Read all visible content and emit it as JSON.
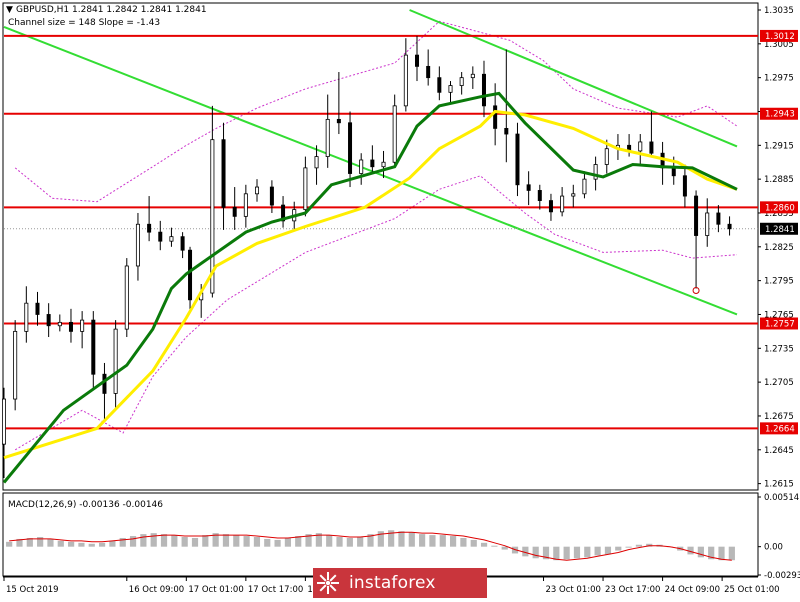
{
  "header": {
    "symbol_line": "GBPUSD,H1  1.2841 1.2842 1.2841 1.2841",
    "channel_line": "Channel size = 148 Slope = -1.43",
    "macd_line": "MACD(12,26,9) -0.00136 -0.00146"
  },
  "watermark": {
    "text": "instaforex"
  },
  "colors": {
    "background": "#ffffff",
    "candles": "#000000",
    "support_resistance": "#e60000",
    "channel": "#33dd33",
    "ma_fast": "#0a7a0a",
    "ma_slow": "#ffee00",
    "envelope": "#cc33cc",
    "macd_bars": "#b8b8b8",
    "macd_signal": "#dd0000"
  },
  "chart_data": [
    {
      "type": "candlestick",
      "symbol": "GBPUSD",
      "timeframe": "H1",
      "ylim": [
        1.2612,
        1.3035
      ],
      "xlim": [
        "2019-10-15 00:00",
        "2019-10-25 05:00"
      ],
      "y_ticks": [
        "1.3035",
        "1.3005",
        "1.2975",
        "1.2945",
        "1.2915",
        "1.2885",
        "1.2855",
        "1.2825",
        "1.2795",
        "1.2765",
        "1.2735",
        "1.2705",
        "1.2675",
        "1.2645",
        "1.2615"
      ],
      "x_ticks": [
        {
          "t": "2019-10-15 00:00",
          "label": "15 Oct 2019"
        },
        {
          "t": "2019-10-16 09:00",
          "label": "16 Oct 09:00"
        },
        {
          "t": "2019-10-17 01:00",
          "label": "17 Oct 01:00"
        },
        {
          "t": "2019-10-17 17:00",
          "label": "17 Oct 17:00"
        },
        {
          "t": "2019-10-18 09:00",
          "label": "18 Oct 09:00"
        },
        {
          "t": "2019-10-23 01:00",
          "label": "23 Oct 01:00"
        },
        {
          "t": "2019-10-23 17:00",
          "label": "23 Oct 17:00"
        },
        {
          "t": "2019-10-24 09:00",
          "label": "24 Oct 09:00"
        },
        {
          "t": "2019-10-25 01:00",
          "label": "25 Oct 01:00"
        }
      ],
      "current_price": {
        "value": 1.2841,
        "label": "1.2841"
      },
      "levels": [
        {
          "value": 1.3012,
          "label": "1.3012"
        },
        {
          "value": 1.2943,
          "label": "1.2943"
        },
        {
          "value": 1.286,
          "label": "1.2860"
        },
        {
          "value": 1.2757,
          "label": "1.2757"
        },
        {
          "value": 1.2664,
          "label": "1.2664"
        }
      ],
      "channel_lines": [
        {
          "from": [
            "2019-10-15 00:00",
            1.302
          ],
          "to": [
            "2019-10-25 05:00",
            1.2765
          ]
        },
        {
          "from": [
            "2019-10-21 13:00",
            1.3035
          ],
          "to": [
            "2019-10-25 05:00",
            1.2914
          ]
        }
      ],
      "ma_fast": [
        [
          "2019-10-15 00:00",
          1.2616
        ],
        [
          "2019-10-15 16:00",
          1.268
        ],
        [
          "2019-10-16 09:00",
          1.272
        ],
        [
          "2019-10-16 16:00",
          1.2752
        ],
        [
          "2019-10-16 21:00",
          1.2788
        ],
        [
          "2019-10-17 01:00",
          1.2801
        ],
        [
          "2019-10-17 04:00",
          1.2808
        ],
        [
          "2019-10-17 17:00",
          1.2838
        ],
        [
          "2019-10-18 00:00",
          1.2847
        ],
        [
          "2019-10-18 09:00",
          1.2855
        ],
        [
          "2019-10-18 16:00",
          1.288
        ],
        [
          "2019-10-21 09:00",
          1.2896
        ],
        [
          "2019-10-21 15:00",
          1.2932
        ],
        [
          "2019-10-21 21:00",
          1.295
        ],
        [
          "2019-10-22 08:00",
          1.2958
        ],
        [
          "2019-10-22 13:00",
          1.2961
        ],
        [
          "2019-10-22 20:00",
          1.2935
        ],
        [
          "2019-10-23 09:00",
          1.2893
        ],
        [
          "2019-10-23 17:00",
          1.2887
        ],
        [
          "2019-10-24 01:00",
          1.2898
        ],
        [
          "2019-10-24 09:00",
          1.2896
        ],
        [
          "2019-10-24 17:00",
          1.2895
        ],
        [
          "2019-10-25 05:00",
          1.2876
        ]
      ],
      "ma_slow": [
        [
          "2019-10-15 00:00",
          1.2638
        ],
        [
          "2019-10-16 01:00",
          1.2664
        ],
        [
          "2019-10-16 16:00",
          1.2715
        ],
        [
          "2019-10-17 01:00",
          1.2762
        ],
        [
          "2019-10-17 09:00",
          1.2808
        ],
        [
          "2019-10-17 20:00",
          1.2828
        ],
        [
          "2019-10-18 09:00",
          1.2843
        ],
        [
          "2019-10-21 01:00",
          1.286
        ],
        [
          "2019-10-21 13:00",
          1.2886
        ],
        [
          "2019-10-21 21:00",
          1.2912
        ],
        [
          "2019-10-22 08:00",
          1.2932
        ],
        [
          "2019-10-22 12:00",
          1.2945
        ],
        [
          "2019-10-22 20:00",
          1.2942
        ],
        [
          "2019-10-23 09:00",
          1.293
        ],
        [
          "2019-10-23 21:00",
          1.2912
        ],
        [
          "2019-10-24 13:00",
          1.29
        ],
        [
          "2019-10-24 21:00",
          1.2885
        ],
        [
          "2019-10-25 05:00",
          1.2876
        ]
      ],
      "envelope_upper": [
        [
          "2019-10-15 03:00",
          1.2895
        ],
        [
          "2019-10-15 13:00",
          1.2868
        ],
        [
          "2019-10-16 01:00",
          1.2865
        ],
        [
          "2019-10-16 16:00",
          1.2896
        ],
        [
          "2019-10-17 01:00",
          1.2915
        ],
        [
          "2019-10-17 09:00",
          1.293
        ],
        [
          "2019-10-17 20:00",
          1.2948
        ],
        [
          "2019-10-18 09:00",
          1.2965
        ],
        [
          "2019-10-21 09:00",
          1.2988
        ],
        [
          "2019-10-21 21:00",
          1.3025
        ],
        [
          "2019-10-22 05:00",
          1.3018
        ],
        [
          "2019-10-22 16:00",
          1.3008
        ],
        [
          "2019-10-23 01:00",
          1.299
        ],
        [
          "2019-10-23 09:00",
          1.2965
        ],
        [
          "2019-10-23 21:00",
          1.2948
        ],
        [
          "2019-10-24 13:00",
          1.294
        ],
        [
          "2019-10-24 21:00",
          1.295
        ],
        [
          "2019-10-25 05:00",
          1.2932
        ]
      ],
      "envelope_lower": [
        [
          "2019-10-15 03:00",
          1.2645
        ],
        [
          "2019-10-15 21:00",
          1.268
        ],
        [
          "2019-10-16 08:00",
          1.266
        ],
        [
          "2019-10-16 16:00",
          1.271
        ],
        [
          "2019-10-17 01:00",
          1.2745
        ],
        [
          "2019-10-17 12:00",
          1.2778
        ],
        [
          "2019-10-18 00:00",
          1.2802
        ],
        [
          "2019-10-18 09:00",
          1.282
        ],
        [
          "2019-10-21 09:00",
          1.285
        ],
        [
          "2019-10-21 21:00",
          1.2876
        ],
        [
          "2019-10-22 08:00",
          1.2888
        ],
        [
          "2019-10-22 20:00",
          1.2855
        ],
        [
          "2019-10-23 04:00",
          1.2836
        ],
        [
          "2019-10-23 17:00",
          1.282
        ],
        [
          "2019-10-24 09:00",
          1.2822
        ],
        [
          "2019-10-24 17:00",
          1.2815
        ],
        [
          "2019-10-25 05:00",
          1.2818
        ]
      ],
      "ohlc": [
        [
          "2019-10-15 00:00",
          1.265,
          1.27,
          1.262,
          1.269
        ],
        [
          "2019-10-15 03:00",
          1.269,
          1.276,
          1.268,
          1.275
        ],
        [
          "2019-10-15 06:00",
          1.275,
          1.279,
          1.274,
          1.2775
        ],
        [
          "2019-10-15 09:00",
          1.2775,
          1.2785,
          1.2755,
          1.2765
        ],
        [
          "2019-10-15 12:00",
          1.2765,
          1.2775,
          1.2745,
          1.2755
        ],
        [
          "2019-10-15 15:00",
          1.2755,
          1.2765,
          1.275,
          1.2758
        ],
        [
          "2019-10-15 18:00",
          1.2758,
          1.277,
          1.274,
          1.275
        ],
        [
          "2019-10-15 21:00",
          1.275,
          1.2768,
          1.2735,
          1.276
        ],
        [
          "2019-10-16 00:00",
          1.276,
          1.2768,
          1.27,
          1.2712
        ],
        [
          "2019-10-16 03:00",
          1.2712,
          1.2722,
          1.267,
          1.2695
        ],
        [
          "2019-10-16 06:00",
          1.2695,
          1.276,
          1.268,
          1.2752
        ],
        [
          "2019-10-16 09:00",
          1.2752,
          1.2815,
          1.2745,
          1.2808
        ],
        [
          "2019-10-16 12:00",
          1.2808,
          1.2855,
          1.2795,
          1.2845
        ],
        [
          "2019-10-16 15:00",
          1.2845,
          1.287,
          1.283,
          1.2838
        ],
        [
          "2019-10-16 18:00",
          1.2838,
          1.2848,
          1.2822,
          1.283
        ],
        [
          "2019-10-16 21:00",
          1.283,
          1.2842,
          1.2825,
          1.2834
        ],
        [
          "2019-10-17 00:00",
          1.2834,
          1.2838,
          1.2815,
          1.2822
        ],
        [
          "2019-10-17 02:00",
          1.2822,
          1.2825,
          1.2768,
          1.2778
        ],
        [
          "2019-10-17 05:00",
          1.2778,
          1.2792,
          1.2762,
          1.2784
        ],
        [
          "2019-10-17 08:00",
          1.2784,
          1.295,
          1.278,
          1.292
        ],
        [
          "2019-10-17 11:00",
          1.292,
          1.2935,
          1.284,
          1.286
        ],
        [
          "2019-10-17 14:00",
          1.286,
          1.2878,
          1.284,
          1.2852
        ],
        [
          "2019-10-17 17:00",
          1.2852,
          1.288,
          1.2842,
          1.2872
        ],
        [
          "2019-10-17 20:00",
          1.2872,
          1.2885,
          1.2865,
          1.2878
        ],
        [
          "2019-10-18 00:00",
          1.2878,
          1.2884,
          1.2855,
          1.2862
        ],
        [
          "2019-10-18 03:00",
          1.2862,
          1.287,
          1.2842,
          1.2848
        ],
        [
          "2019-10-18 06:00",
          1.2848,
          1.2865,
          1.284,
          1.2858
        ],
        [
          "2019-10-18 09:00",
          1.2858,
          1.2905,
          1.2852,
          1.2895
        ],
        [
          "2019-10-18 12:00",
          1.2895,
          1.2915,
          1.288,
          1.2905
        ],
        [
          "2019-10-18 15:00",
          1.2905,
          1.296,
          1.2895,
          1.2938
        ],
        [
          "2019-10-18 18:00",
          1.2938,
          1.298,
          1.2925,
          1.2935
        ],
        [
          "2019-10-18 21:00",
          1.2935,
          1.2945,
          1.2878,
          1.289
        ],
        [
          "2019-10-21 00:00",
          1.289,
          1.2908,
          1.288,
          1.2902
        ],
        [
          "2019-10-21 03:00",
          1.2902,
          1.2915,
          1.289,
          1.2896
        ],
        [
          "2019-10-21 06:00",
          1.2896,
          1.291,
          1.2886,
          1.29
        ],
        [
          "2019-10-21 09:00",
          1.29,
          1.296,
          1.2895,
          1.295
        ],
        [
          "2019-10-21 12:00",
          1.295,
          1.301,
          1.2945,
          1.2995
        ],
        [
          "2019-10-21 15:00",
          1.2995,
          1.3012,
          1.2972,
          1.2985
        ],
        [
          "2019-10-21 18:00",
          1.2985,
          1.3,
          1.2968,
          1.2975
        ],
        [
          "2019-10-21 21:00",
          1.2975,
          1.2985,
          1.2955,
          1.2962
        ],
        [
          "2019-10-22 00:00",
          1.2962,
          1.2972,
          1.2952,
          1.2968
        ],
        [
          "2019-10-22 03:00",
          1.2968,
          1.298,
          1.296,
          1.2975
        ],
        [
          "2019-10-22 06:00",
          1.2975,
          1.2985,
          1.2965,
          1.2978
        ],
        [
          "2019-10-22 09:00",
          1.2978,
          1.299,
          1.294,
          1.295
        ],
        [
          "2019-10-22 12:00",
          1.295,
          1.297,
          1.2915,
          1.293
        ],
        [
          "2019-10-22 15:00",
          1.293,
          1.3,
          1.29,
          1.2925
        ],
        [
          "2019-10-22 18:00",
          1.2925,
          1.2935,
          1.287,
          1.288
        ],
        [
          "2019-10-22 21:00",
          1.288,
          1.2892,
          1.2862,
          1.2875
        ],
        [
          "2019-10-23 00:00",
          1.2875,
          1.288,
          1.2858,
          1.2866
        ],
        [
          "2019-10-23 03:00",
          1.2866,
          1.2872,
          1.2848,
          1.2856
        ],
        [
          "2019-10-23 06:00",
          1.2856,
          1.2878,
          1.2852,
          1.287
        ],
        [
          "2019-10-23 09:00",
          1.287,
          1.288,
          1.286,
          1.2872
        ],
        [
          "2019-10-23 12:00",
          1.2872,
          1.2892,
          1.2868,
          1.2885
        ],
        [
          "2019-10-23 15:00",
          1.2885,
          1.2905,
          1.2875,
          1.2898
        ],
        [
          "2019-10-23 18:00",
          1.2898,
          1.292,
          1.289,
          1.2912
        ],
        [
          "2019-10-23 21:00",
          1.2912,
          1.2925,
          1.2902,
          1.2915
        ],
        [
          "2019-10-24 00:00",
          1.2915,
          1.2925,
          1.2905,
          1.291
        ],
        [
          "2019-10-24 03:00",
          1.291,
          1.2925,
          1.2898,
          1.2918
        ],
        [
          "2019-10-24 06:00",
          1.2918,
          1.2945,
          1.2905,
          1.2908
        ],
        [
          "2019-10-24 09:00",
          1.2908,
          1.2918,
          1.288,
          1.2895
        ],
        [
          "2019-10-24 12:00",
          1.2895,
          1.2905,
          1.288,
          1.2888
        ],
        [
          "2019-10-24 15:00",
          1.2888,
          1.2898,
          1.286,
          1.287
        ],
        [
          "2019-10-24 18:00",
          1.287,
          1.2875,
          1.2788,
          1.2835
        ],
        [
          "2019-10-24 21:00",
          1.2835,
          1.2868,
          1.2825,
          1.2855
        ],
        [
          "2019-10-25 00:00",
          1.2855,
          1.2862,
          1.2838,
          1.2845
        ],
        [
          "2019-10-25 03:00",
          1.2845,
          1.2852,
          1.2835,
          1.2841
        ]
      ]
    },
    {
      "type": "macd",
      "label": "MACD(12,26,9)",
      "values": {
        "main": -0.00136,
        "signal": -0.00146
      },
      "ylim": [
        -0.00293,
        0.00514
      ],
      "y_ticks": [
        "0.00514",
        "0.00",
        "-0.00293"
      ],
      "histogram": [
        0.0005,
        0.0008,
        0.0009,
        0.001,
        0.0008,
        0.0006,
        0.0005,
        0.0004,
        0.0003,
        0.0004,
        0.0006,
        0.0009,
        0.0011,
        0.0013,
        0.0014,
        0.0013,
        0.0012,
        0.001,
        0.0009,
        0.0012,
        0.0014,
        0.0013,
        0.0012,
        0.0011,
        0.001,
        0.0008,
        0.0007,
        0.0009,
        0.0011,
        0.0013,
        0.0014,
        0.0012,
        0.001,
        0.0009,
        0.001,
        0.0013,
        0.0016,
        0.0017,
        0.0016,
        0.0015,
        0.0013,
        0.0012,
        0.0012,
        0.0011,
        0.0009,
        0.0007,
        0.0004,
        0.0001,
        -0.0003,
        -0.0007,
        -0.001,
        -0.0012,
        -0.0013,
        -0.0014,
        -0.0013,
        -0.0012,
        -0.0011,
        -0.0009,
        -0.0008,
        -0.0004,
        -0.0001,
        0.0002,
        0.0003,
        0.0002,
        0.0,
        -0.0004,
        -0.0008,
        -0.0011,
        -0.0013,
        -0.0014,
        -0.0014
      ],
      "signal_line": [
        0.0006,
        0.0007,
        0.0008,
        0.0008,
        0.0008,
        0.0007,
        0.0006,
        0.0006,
        0.0005,
        0.0005,
        0.0006,
        0.0007,
        0.0008,
        0.001,
        0.0011,
        0.0012,
        0.0012,
        0.0011,
        0.0011,
        0.0011,
        0.0012,
        0.0012,
        0.0012,
        0.0012,
        0.0011,
        0.001,
        0.0009,
        0.0009,
        0.001,
        0.0011,
        0.0012,
        0.0012,
        0.0011,
        0.001,
        0.001,
        0.0011,
        0.0013,
        0.0014,
        0.0015,
        0.0015,
        0.0014,
        0.0014,
        0.0013,
        0.0012,
        0.0011,
        0.0009,
        0.0007,
        0.0004,
        0.0001,
        -0.0003,
        -0.0006,
        -0.0009,
        -0.0011,
        -0.0013,
        -0.0014,
        -0.0013,
        -0.0012,
        -0.001,
        -0.0008,
        -0.0006,
        -0.0003,
        -0.0001,
        0.0001,
        0.0001,
        0.0,
        -0.0002,
        -0.0005,
        -0.0008,
        -0.0011,
        -0.0013,
        -0.0014
      ]
    }
  ]
}
